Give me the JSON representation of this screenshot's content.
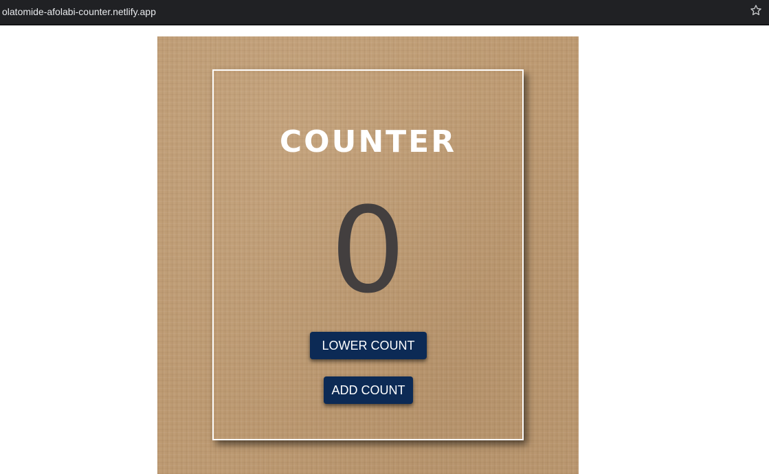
{
  "browser": {
    "url": "olatomide-afolabi-counter.netlify.app",
    "bookmark_icon": "star-icon"
  },
  "counter": {
    "title": "COUNTER",
    "value": "0",
    "lower_label": "LOWER COUNT",
    "add_label": "ADD COUNT"
  },
  "colors": {
    "button_bg": "#0c2a55",
    "count_text": "#433f3f",
    "background": "#bd9a72"
  }
}
